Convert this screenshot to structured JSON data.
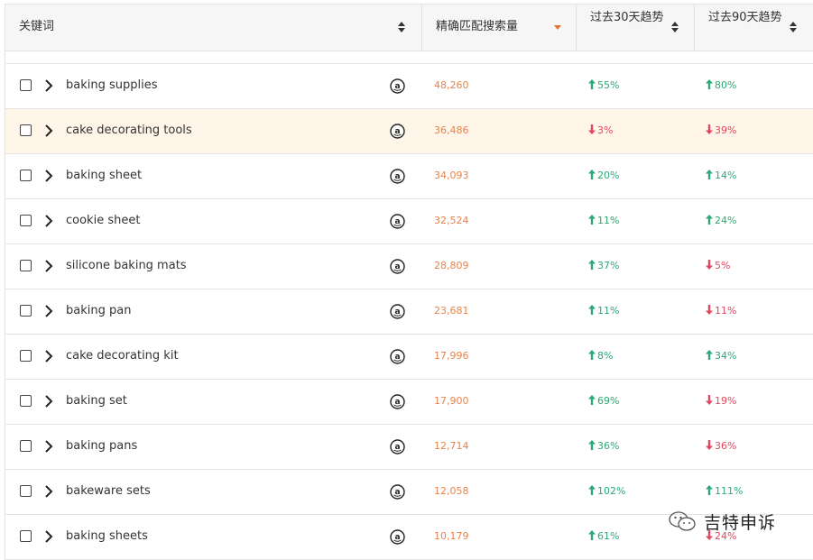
{
  "header": {
    "keyword": "关键词",
    "volume": "精确匹配搜索量",
    "trend30": "过去30天趋势",
    "trend90": "过去90天趋势"
  },
  "rows": [
    {
      "keyword": "baking supplies",
      "volume": "48,260",
      "t30": "55%",
      "t30_dir": "up",
      "t90": "80%",
      "t90_dir": "up"
    },
    {
      "keyword": "cake decorating tools",
      "volume": "36,486",
      "t30": "3%",
      "t30_dir": "down",
      "t90": "39%",
      "t90_dir": "down",
      "highlighted": true
    },
    {
      "keyword": "baking sheet",
      "volume": "34,093",
      "t30": "20%",
      "t30_dir": "up",
      "t90": "14%",
      "t90_dir": "up"
    },
    {
      "keyword": "cookie sheet",
      "volume": "32,524",
      "t30": "11%",
      "t30_dir": "up",
      "t90": "24%",
      "t90_dir": "up"
    },
    {
      "keyword": "silicone baking mats",
      "volume": "28,809",
      "t30": "37%",
      "t30_dir": "up",
      "t90": "5%",
      "t90_dir": "down"
    },
    {
      "keyword": "baking pan",
      "volume": "23,681",
      "t30": "11%",
      "t30_dir": "up",
      "t90": "11%",
      "t90_dir": "down"
    },
    {
      "keyword": "cake decorating kit",
      "volume": "17,996",
      "t30": "8%",
      "t30_dir": "up",
      "t90": "34%",
      "t90_dir": "up"
    },
    {
      "keyword": "baking set",
      "volume": "17,900",
      "t30": "69%",
      "t30_dir": "up",
      "t90": "19%",
      "t90_dir": "down"
    },
    {
      "keyword": "baking pans",
      "volume": "12,714",
      "t30": "36%",
      "t30_dir": "up",
      "t90": "36%",
      "t90_dir": "down"
    },
    {
      "keyword": "bakeware sets",
      "volume": "12,058",
      "t30": "102%",
      "t30_dir": "up",
      "t90": "111%",
      "t90_dir": "up"
    },
    {
      "keyword": "baking sheets",
      "volume": "10,179",
      "t30": "61%",
      "t30_dir": "up",
      "t90": "24%",
      "t90_dir": "down"
    }
  ],
  "icons": {
    "expand": "chevron-right-icon",
    "amazon": "amazon-icon",
    "up": "arrow-up-icon",
    "down": "arrow-down-icon"
  },
  "colors": {
    "up": "#2aa876",
    "down": "#e2475d",
    "volume": "#e8834a",
    "highlight": "#fff5e9",
    "sort_active": "#e8712a"
  },
  "watermark": {
    "text": "吉特申诉"
  }
}
